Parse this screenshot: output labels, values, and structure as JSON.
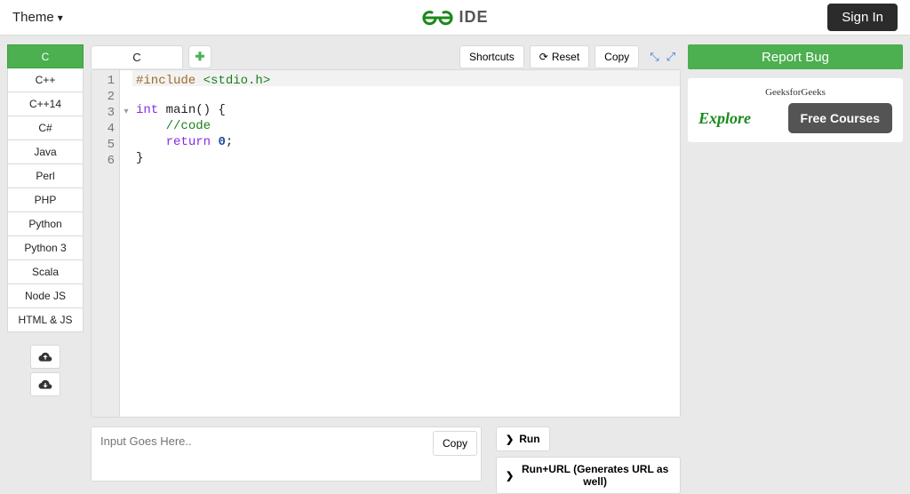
{
  "header": {
    "theme_label": "Theme",
    "ide_label": "IDE",
    "signin_label": "Sign In"
  },
  "sidebar": {
    "languages": [
      "C",
      "C++",
      "C++14",
      "C#",
      "Java",
      "Perl",
      "PHP",
      "Python",
      "Python 3",
      "Scala",
      "Node JS",
      "HTML & JS"
    ],
    "active_index": 0
  },
  "tabs": {
    "items": [
      "C"
    ]
  },
  "toolbar": {
    "shortcuts_label": "Shortcuts",
    "reset_label": "Reset",
    "copy_label": "Copy"
  },
  "code": {
    "lines": [
      {
        "n": 1,
        "tokens": [
          {
            "t": "tok-pre",
            "v": "#include"
          },
          {
            "t": "",
            "v": " "
          },
          {
            "t": "tok-str",
            "v": "<stdio.h>"
          }
        ],
        "hl": true
      },
      {
        "n": 2,
        "tokens": []
      },
      {
        "n": 3,
        "tokens": [
          {
            "t": "tok-kw",
            "v": "int"
          },
          {
            "t": "",
            "v": " "
          },
          {
            "t": "tok-fn",
            "v": "main() {"
          }
        ],
        "fold": true
      },
      {
        "n": 4,
        "tokens": [
          {
            "t": "",
            "v": "    "
          },
          {
            "t": "tok-com",
            "v": "//code"
          }
        ]
      },
      {
        "n": 5,
        "tokens": [
          {
            "t": "",
            "v": "    "
          },
          {
            "t": "tok-kw",
            "v": "return"
          },
          {
            "t": "",
            "v": " "
          },
          {
            "t": "tok-num",
            "v": "0"
          },
          {
            "t": "",
            "v": ";"
          }
        ]
      },
      {
        "n": 6,
        "tokens": [
          {
            "t": "",
            "v": "}"
          }
        ]
      }
    ]
  },
  "input": {
    "placeholder": "Input Goes Here..",
    "copy_label": "Copy"
  },
  "run": {
    "run_label": "Run",
    "run_url_label": "Run+URL (Generates URL as well)"
  },
  "right": {
    "report_bug_label": "Report Bug",
    "promo_brand": "GeeksforGeeks",
    "explore_label": "Explore",
    "free_courses_label": "Free Courses"
  }
}
